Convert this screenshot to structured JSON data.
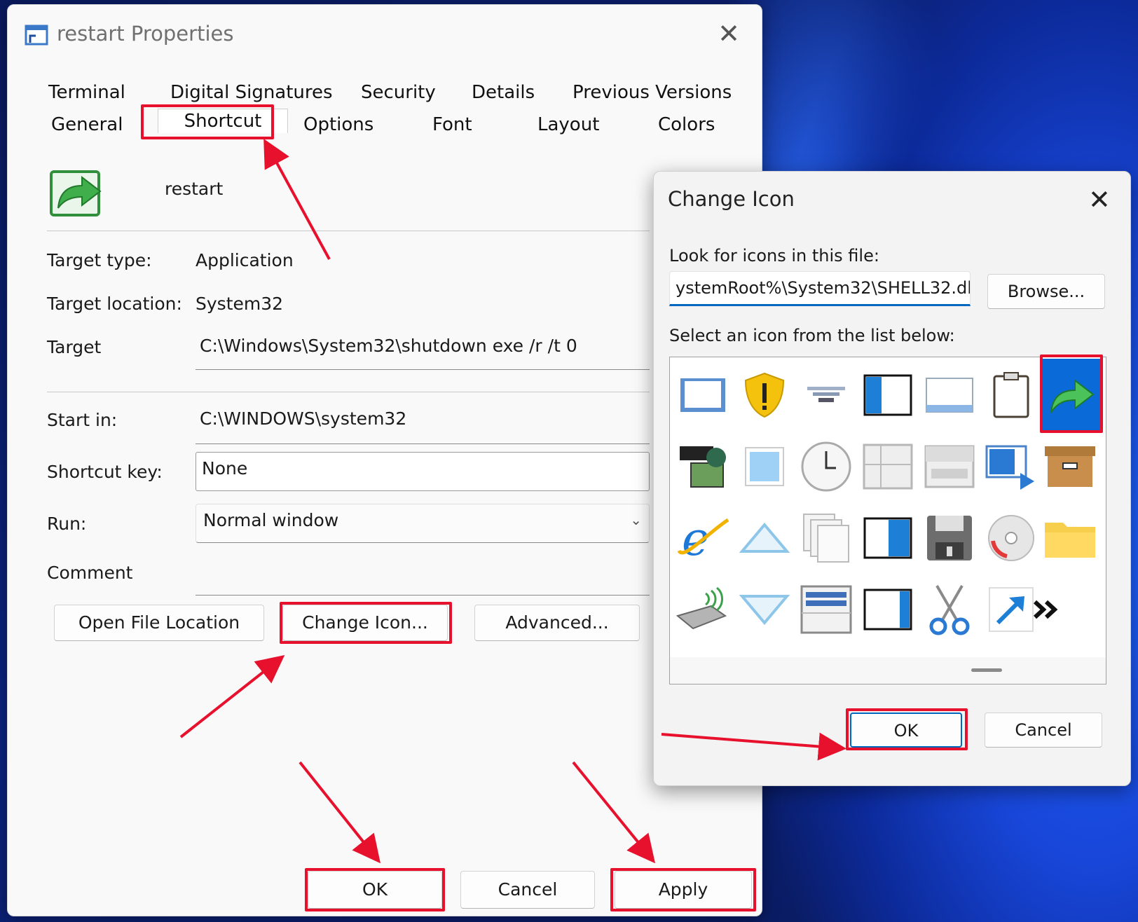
{
  "properties": {
    "title": "restart Properties",
    "tabs_row1": [
      "Terminal",
      "Digital Signatures",
      "Security",
      "Details",
      "Previous Versions"
    ],
    "tabs_row2": [
      "General",
      "Shortcut",
      "Options",
      "Font",
      "Layout",
      "Colors"
    ],
    "active_tab": "Shortcut",
    "shortcut_name": "restart",
    "fields": {
      "target_type_label": "Target type:",
      "target_type_value": "Application",
      "target_location_label": "Target location:",
      "target_location_value": "System32",
      "target_label": "Target",
      "target_value": "C:\\Windows\\System32\\shutdown exe /r /t 0",
      "start_in_label": "Start in:",
      "start_in_value": "C:\\WINDOWS\\system32",
      "shortcut_key_label": "Shortcut key:",
      "shortcut_key_value": "None",
      "run_label": "Run:",
      "run_value": "Normal window",
      "comment_label": "Comment",
      "comment_value": ""
    },
    "buttons": {
      "open_file_location": "Open File Location",
      "change_icon": "Change Icon...",
      "advanced": "Advanced...",
      "ok": "OK",
      "cancel": "Cancel",
      "apply": "Apply"
    }
  },
  "change_icon": {
    "title": "Change Icon",
    "look_label": "Look for icons in this file:",
    "file_path": "ystemRoot%\\System32\\SHELL32.dll",
    "browse": "Browse...",
    "select_label": "Select an icon from the list below:",
    "icons": [
      "window-icon",
      "shield-warning-icon",
      "network-icon",
      "split-window-icon",
      "blank-window-icon",
      "clipboard-icon",
      "shortcut-arrow-icon",
      "media-icon",
      "square-icon",
      "clock-icon",
      "grid-window-icon",
      "dashboard-window-icon",
      "window-play-icon",
      "archive-box-icon",
      "internet-explorer-icon",
      "triangle-up-icon",
      "stacked-pages-icon",
      "split-window-right-icon",
      "floppy-disk-icon",
      "cd-drive-icon",
      "folder-icon",
      "usb-device-icon",
      "triangle-down-icon",
      "table-window-icon",
      "half-window-icon",
      "scissors-icon",
      "diagonal-arrow-icon",
      "double-chevron-icon"
    ],
    "selected_icon": "shortcut-arrow-icon",
    "ok": "OK",
    "cancel": "Cancel"
  },
  "colors": {
    "highlight": "#e8112d",
    "accent": "#0067c0",
    "selected_icon_bg": "#0a6ad8"
  }
}
